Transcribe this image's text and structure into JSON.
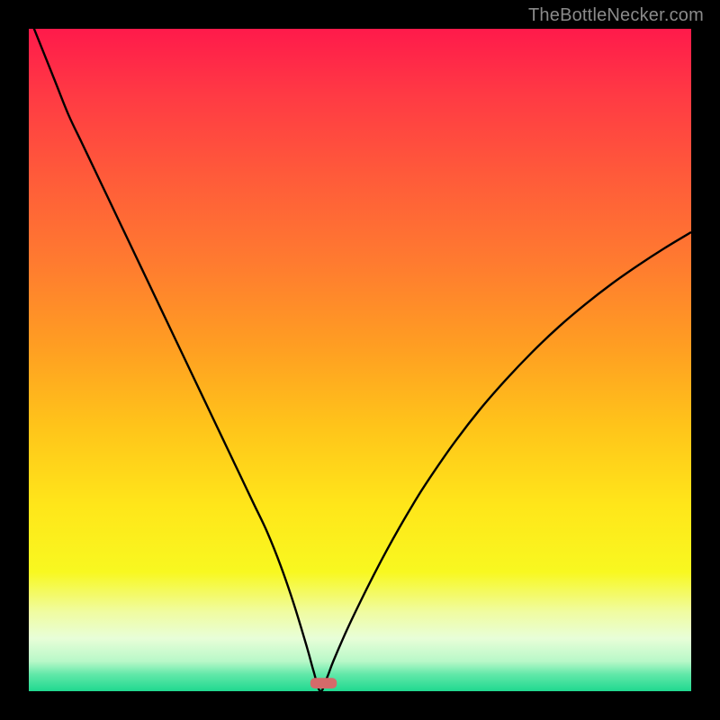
{
  "watermark": "TheBottleNecker.com",
  "colors": {
    "background": "#000000",
    "curve": "#000000",
    "marker": "#d46a6a"
  },
  "gradient_stops": [
    {
      "offset": 0.0,
      "color": "#ff1a4b"
    },
    {
      "offset": 0.1,
      "color": "#ff3a44"
    },
    {
      "offset": 0.22,
      "color": "#ff5a3a"
    },
    {
      "offset": 0.35,
      "color": "#ff7a30"
    },
    {
      "offset": 0.48,
      "color": "#ff9e22"
    },
    {
      "offset": 0.6,
      "color": "#ffc41a"
    },
    {
      "offset": 0.72,
      "color": "#ffe61a"
    },
    {
      "offset": 0.82,
      "color": "#f8f820"
    },
    {
      "offset": 0.88,
      "color": "#f0fca0"
    },
    {
      "offset": 0.92,
      "color": "#e8fed8"
    },
    {
      "offset": 0.955,
      "color": "#b8f8c8"
    },
    {
      "offset": 0.975,
      "color": "#60e8a8"
    },
    {
      "offset": 1.0,
      "color": "#20d890"
    }
  ],
  "chart_data": {
    "type": "line",
    "title": "",
    "xlabel": "",
    "ylabel": "",
    "xlim": [
      0,
      100
    ],
    "ylim": [
      0,
      100
    ],
    "x": [
      0,
      2,
      4,
      6,
      8,
      10,
      12,
      14,
      16,
      18,
      20,
      22,
      24,
      26,
      28,
      30,
      32,
      34,
      36,
      38,
      40,
      42,
      43,
      44,
      45,
      46,
      48,
      50,
      52,
      54,
      56,
      58,
      60,
      64,
      68,
      72,
      76,
      80,
      84,
      88,
      92,
      96,
      100
    ],
    "values": [
      102,
      97,
      92,
      87,
      82.8,
      78.6,
      74.4,
      70.2,
      66,
      61.8,
      57.6,
      53.4,
      49.2,
      45,
      40.8,
      36.6,
      32.4,
      28.2,
      24,
      19,
      13.2,
      6.6,
      3.0,
      0.0,
      2.0,
      4.6,
      9.2,
      13.4,
      17.4,
      21.2,
      24.8,
      28.2,
      31.4,
      37.2,
      42.4,
      47.0,
      51.2,
      55.0,
      58.4,
      61.5,
      64.3,
      66.9,
      69.3
    ],
    "marker": {
      "x_range": [
        42.5,
        46.5
      ],
      "y": 0.4,
      "height": 1.6
    }
  }
}
